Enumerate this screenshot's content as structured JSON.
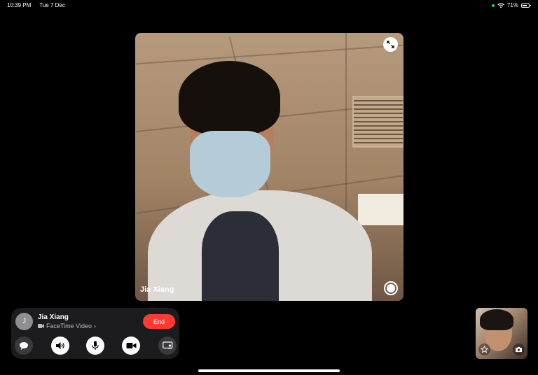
{
  "status_bar": {
    "time": "10:39 PM",
    "date": "Tue 7 Dec",
    "battery": "71%",
    "battery_level": 0.71
  },
  "remote_video": {
    "caller_name": "Jia Xiang"
  },
  "call_panel": {
    "avatar_initial": "J",
    "caller_name": "Jia Xiang",
    "call_type": "FaceTime Video",
    "end_label": "End"
  },
  "controls": [
    "message-icon",
    "speaker-icon",
    "microphone-icon",
    "camera-icon",
    "screen-share-icon"
  ],
  "self_view": {
    "effects_icon": "star-icon",
    "flip_icon": "camera-flip-icon"
  }
}
